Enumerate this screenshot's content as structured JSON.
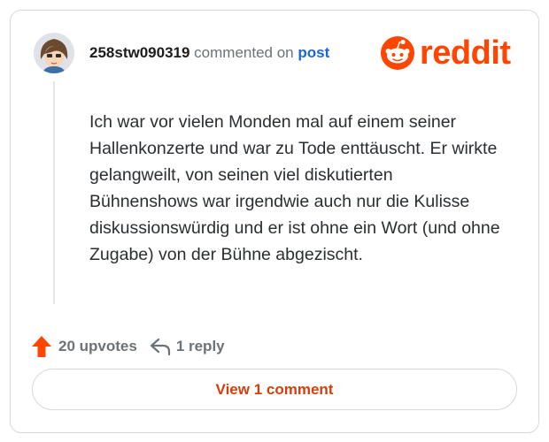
{
  "comment": {
    "username": "258stw090319",
    "action_text": "commented on",
    "post_link_label": "post",
    "body": "Ich war vor vielen Monden mal auf einem seiner Hallenkonzerte und war zu Tode enttäuscht. Er wirkte gelangweilt, von seinen viel diskutierten Bühnenshows war irgendwie auch nur die Kulisse diskussionswürdig und er ist ohne ein Wort (und ohne Zugabe) von der Bühne abgezischt."
  },
  "brand": {
    "logo_text": "reddit",
    "logo_icon": "reddit-snoo-icon",
    "accent_color": "#ff4500"
  },
  "actions": {
    "upvotes_label": "20 upvotes",
    "upvote_icon": "upvote-arrow-icon",
    "reply_label": "1 reply",
    "reply_icon": "reply-arrow-icon"
  },
  "view_button": {
    "label": "View 1 comment"
  },
  "colors": {
    "link": "#1b66d6",
    "upvote": "#ff4500",
    "button_text": "#d43e0a",
    "muted": "#6b7378"
  }
}
